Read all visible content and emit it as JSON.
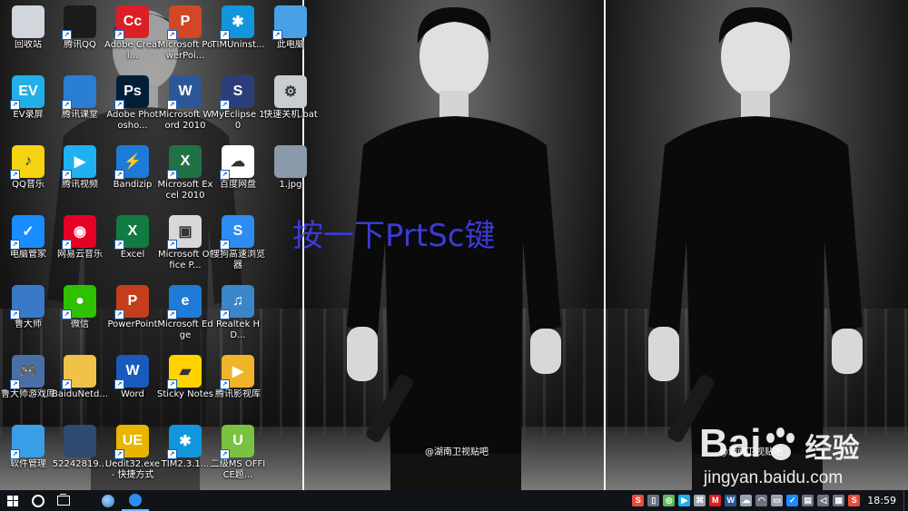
{
  "overlay_text": "按一下PrtSc键",
  "wallpaper": {
    "caption_center": "@湖南卫视贴吧",
    "caption_right": "@湖南卫视贴吧"
  },
  "watermark": {
    "logo_left": "Bai",
    "logo_right": "百度",
    "logo_jingyan": "经验",
    "url": "jingyan.baidu.com"
  },
  "desktop_icons": [
    {
      "id": "recycle-bin",
      "label": "回收站",
      "icon": "recycle-bin-icon",
      "color": "#d0d6dc"
    },
    {
      "id": "tencent-qq",
      "label": "腾讯QQ",
      "icon": "qq-penguin-icon",
      "color": "#1b1b1b"
    },
    {
      "id": "adobe-creative",
      "label": "Adobe Creati...",
      "icon": "adobe-cc-icon",
      "color": "#da1f26",
      "glyph": "Cc"
    },
    {
      "id": "powerpoint-2010",
      "label": "Microsoft PowerPoi...",
      "icon": "powerpoint-2010-icon",
      "color": "#d24726",
      "glyph": "P"
    },
    {
      "id": "tim-uninstall",
      "label": "TIMUninst...",
      "icon": "tim-star-icon",
      "color": "#1296db",
      "glyph": "✱"
    },
    {
      "id": "this-pc",
      "label": "此电脑",
      "icon": "computer-monitor-icon",
      "color": "#4aa0e6"
    },
    {
      "id": "ev-screen",
      "label": "EV录屏",
      "icon": "ev-recorder-icon",
      "color": "#23b0e8",
      "glyph": "EV"
    },
    {
      "id": "tencent-class",
      "label": "腾讯课堂",
      "icon": "tencent-classroom-icon",
      "color": "#2a7fd4"
    },
    {
      "id": "photoshop",
      "label": "Adobe Photosho...",
      "icon": "photoshop-icon",
      "color": "#001e36",
      "glyph": "Ps"
    },
    {
      "id": "word-2010",
      "label": "Microsoft Word 2010",
      "icon": "word-2010-icon",
      "color": "#2b5797",
      "glyph": "W"
    },
    {
      "id": "myeclipse",
      "label": "MyEclipse 10",
      "icon": "myeclipse-icon",
      "color": "#2c3e7a",
      "glyph": "S"
    },
    {
      "id": "shutdown-bat",
      "label": "快速关机.bat",
      "icon": "gear-file-icon",
      "color": "#c9cdd2",
      "glyph": "⚙"
    },
    {
      "id": "qq-music",
      "label": "QQ音乐",
      "icon": "qq-music-icon",
      "color": "#f5d313",
      "glyph": "♪"
    },
    {
      "id": "tencent-video",
      "label": "腾讯视频",
      "icon": "tencent-video-icon",
      "color": "#1eb0f0",
      "glyph": "▶"
    },
    {
      "id": "bandizip",
      "label": "Bandizip",
      "icon": "bandizip-icon",
      "color": "#1e7ad8",
      "glyph": "⚡"
    },
    {
      "id": "excel-2010",
      "label": "Microsoft Excel 2010",
      "icon": "excel-2010-icon",
      "color": "#207245",
      "glyph": "X"
    },
    {
      "id": "baidu-netdisk",
      "label": "百度网盘",
      "icon": "baidu-netdisk-icon",
      "color": "#ffffff",
      "glyph": "☁"
    },
    {
      "id": "image-1jpg",
      "label": "1.jpg",
      "icon": "image-file-icon",
      "color": "#8a9aa8"
    },
    {
      "id": "pc-manager",
      "label": "电脑管家",
      "icon": "pc-manager-shield-icon",
      "color": "#1a8cff",
      "glyph": "✓"
    },
    {
      "id": "netease-music",
      "label": "网易云音乐",
      "icon": "netease-music-icon",
      "color": "#e60026",
      "glyph": "◉"
    },
    {
      "id": "excel",
      "label": "Excel",
      "icon": "excel-icon",
      "color": "#107c41",
      "glyph": "X"
    },
    {
      "id": "office-picture",
      "label": "Microsoft Office P...",
      "icon": "office-picture-icon",
      "color": "#d8d8d8",
      "glyph": "▣"
    },
    {
      "id": "sogou-browser",
      "label": "搜狗高速浏览器",
      "icon": "sogou-browser-icon",
      "color": "#2d8cf0",
      "glyph": "S"
    },
    {
      "id": "ludashi",
      "label": "鲁大师",
      "icon": "ludashi-icon",
      "color": "#3a78c8"
    },
    {
      "id": "wechat",
      "label": "微信",
      "icon": "wechat-icon",
      "color": "#2dc100",
      "glyph": "●"
    },
    {
      "id": "powerpoint",
      "label": "PowerPoint",
      "icon": "powerpoint-icon",
      "color": "#c43e1c",
      "glyph": "P"
    },
    {
      "id": "edge",
      "label": "Microsoft Edge",
      "icon": "edge-icon",
      "color": "#1e7bd8",
      "glyph": "e"
    },
    {
      "id": "realtek",
      "label": "Realtek HD...",
      "icon": "realtek-audio-icon",
      "color": "#3a86c8",
      "glyph": "♫"
    },
    {
      "id": "ludashi-games",
      "label": "鲁大师游戏库",
      "icon": "game-library-icon",
      "color": "#4a6fa5",
      "glyph": "🎮"
    },
    {
      "id": "baidu-netdisk-folder",
      "label": "BaiduNetd...",
      "icon": "folder-icon",
      "color": "#f0c24a"
    },
    {
      "id": "word",
      "label": "Word",
      "icon": "word-icon",
      "color": "#185abd",
      "glyph": "W"
    },
    {
      "id": "sticky-notes",
      "label": "Sticky Notes",
      "icon": "sticky-notes-icon",
      "color": "#ffd300",
      "glyph": "▰"
    },
    {
      "id": "tencent-film",
      "label": "腾讯影视库",
      "icon": "film-folder-icon",
      "color": "#f0b429",
      "glyph": "▶"
    },
    {
      "id": "software-manager",
      "label": "软件管理",
      "icon": "software-manager-icon",
      "color": "#3a9de8"
    },
    {
      "id": "photo-5224",
      "label": "52242819...",
      "icon": "photo-thumbnail-icon",
      "color": "#2e4a6e"
    },
    {
      "id": "uedit32",
      "label": "Uedit32.exe - 快捷方式",
      "icon": "ultraedit-icon",
      "color": "#e8b500",
      "glyph": "UE"
    },
    {
      "id": "tim231",
      "label": "TIM2.3.1...",
      "icon": "tim-installer-icon",
      "color": "#1296db",
      "glyph": "✱"
    },
    {
      "id": "office-level2",
      "label": "二级MS OFFICE题...",
      "icon": "office-exam-icon",
      "color": "#7cc242",
      "glyph": "U"
    }
  ],
  "taskbar": {
    "clock": "18:59",
    "tray_items": [
      {
        "icon": "sogou-input-icon",
        "color": "#e74c3c",
        "glyph": "S"
      },
      {
        "icon": "phone-icon",
        "color": "#6b7280",
        "glyph": "▯"
      },
      {
        "icon": "360-icon",
        "color": "#5cb85c",
        "glyph": "◎"
      },
      {
        "icon": "video-play-icon",
        "color": "#1eb0f0",
        "glyph": "▶"
      },
      {
        "icon": "game-icon",
        "color": "#9ca3af",
        "glyph": "⌘"
      },
      {
        "icon": "antivirus-icon",
        "color": "#d92020",
        "glyph": "M"
      },
      {
        "icon": "word-tray-icon",
        "color": "#2b5797",
        "glyph": "W"
      },
      {
        "icon": "cloud-icon",
        "color": "#9ca3af",
        "glyph": "☁"
      },
      {
        "icon": "wifi-icon",
        "color": "#6b7280",
        "glyph": "◠"
      },
      {
        "icon": "battery-icon",
        "color": "#9ca3af",
        "glyph": "▭"
      },
      {
        "icon": "shield-icon",
        "color": "#1a8cff",
        "glyph": "✓"
      },
      {
        "icon": "network-icon",
        "color": "#6b7280",
        "glyph": "▤"
      },
      {
        "icon": "volume-icon",
        "color": "#6b7280",
        "glyph": "◁"
      },
      {
        "icon": "ime-icon",
        "color": "#6b7280",
        "glyph": "▦"
      },
      {
        "icon": "sogou-tray-icon",
        "color": "#e74c3c",
        "glyph": "S"
      }
    ]
  }
}
